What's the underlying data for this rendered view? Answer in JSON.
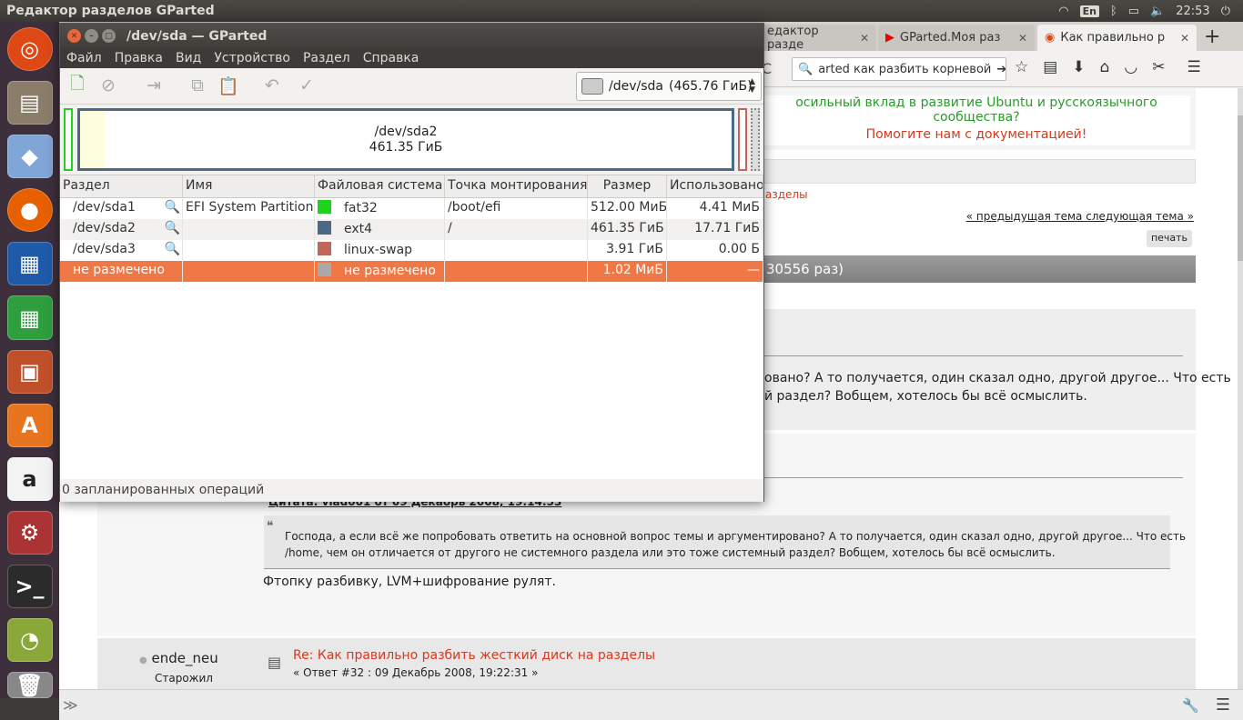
{
  "topbar": {
    "title": "Редактор разделов GParted",
    "lang": "En",
    "time": "22:53"
  },
  "launcher": [
    "dash-icon",
    "files-icon",
    "cube-icon",
    "firefox-icon",
    "writer-icon",
    "calc-icon",
    "impress-icon",
    "software-center-icon",
    "amazon-icon",
    "settings-icon",
    "terminal-icon",
    "gparted-icon",
    "trash-icon"
  ],
  "browser": {
    "tabs": [
      {
        "label": "едактор разде"
      },
      {
        "label": "GParted.Моя раз"
      },
      {
        "label": "Как правильно р"
      }
    ],
    "address": "arted как разбить корневой",
    "page": {
      "banner1": "осильный вклад в развитие Ubuntu и русскоязычного сообщества?",
      "banner2": "Помогите нам с документацией!",
      "partitions_link": "азделы",
      "prev_topic": "« предыдущая тема",
      "next_topic": "следующая тема »",
      "print_btn": "печать",
      "views": "30556 раз)",
      "q1a": "овано? А то получается, один сказал одно, другой другое... Что есть",
      "q1b": "й раздел? Вобщем, хотелось бы всё осмыслить.",
      "quote_header": "Цитата: vlad001 от 09 Декабрь 2008, 19:14:53",
      "quote_text1": "Господа, а если всё же попробовать ответить на основной вопрос темы и аргументировано? А то получается, один сказал одно, другой другое... Что есть",
      "quote_text2": "/home, чем он отличается от другого не системного раздела или это тоже системный раздел? Вобщем, хотелось бы всё осмыслить.",
      "reply_text": "Фтопку разбивку, LVM+шифрование рулят.",
      "author": "ende_neu",
      "author_rank": "Старожил",
      "post_title": "Re: Как правильно разбить жесткий диск на разделы",
      "post_meta": "« Ответ #32 : 09 Декабрь 2008, 19:22:31 »"
    }
  },
  "gparted": {
    "title": "/dev/sda — GParted",
    "menu": [
      "Файл",
      "Правка",
      "Вид",
      "Устройство",
      "Раздел",
      "Справка"
    ],
    "device": "/dev/sda",
    "device_size": "(465.76 ГиБ)",
    "vis_label": "/dev/sda2",
    "vis_size": "461.35 ГиБ",
    "columns": [
      "Раздел",
      "Имя",
      "Файловая система",
      "Точка монтирования",
      "Размер",
      "Использовано"
    ],
    "rows": [
      {
        "part": "/dev/sda1",
        "name": "EFI System Partition",
        "fs": "fat32",
        "mount": "/boot/efi",
        "size": "512.00 МиБ",
        "used": "4.41 МиБ",
        "color": "#1ed31e",
        "locked": true
      },
      {
        "part": "/dev/sda2",
        "name": "",
        "fs": "ext4",
        "mount": "/",
        "size": "461.35 ГиБ",
        "used": "17.71 ГиБ",
        "color": "#4b6983",
        "locked": true
      },
      {
        "part": "/dev/sda3",
        "name": "",
        "fs": "linux-swap",
        "mount": "",
        "size": "3.91 ГиБ",
        "used": "0.00 Б",
        "color": "#c1665a",
        "locked": true
      },
      {
        "part": "не размечено",
        "name": "",
        "fs": "не размечено",
        "mount": "",
        "size": "1.02 МиБ",
        "used": "—",
        "color": "#a9a9a9",
        "locked": false
      }
    ],
    "status": "0 запланированных операций"
  }
}
